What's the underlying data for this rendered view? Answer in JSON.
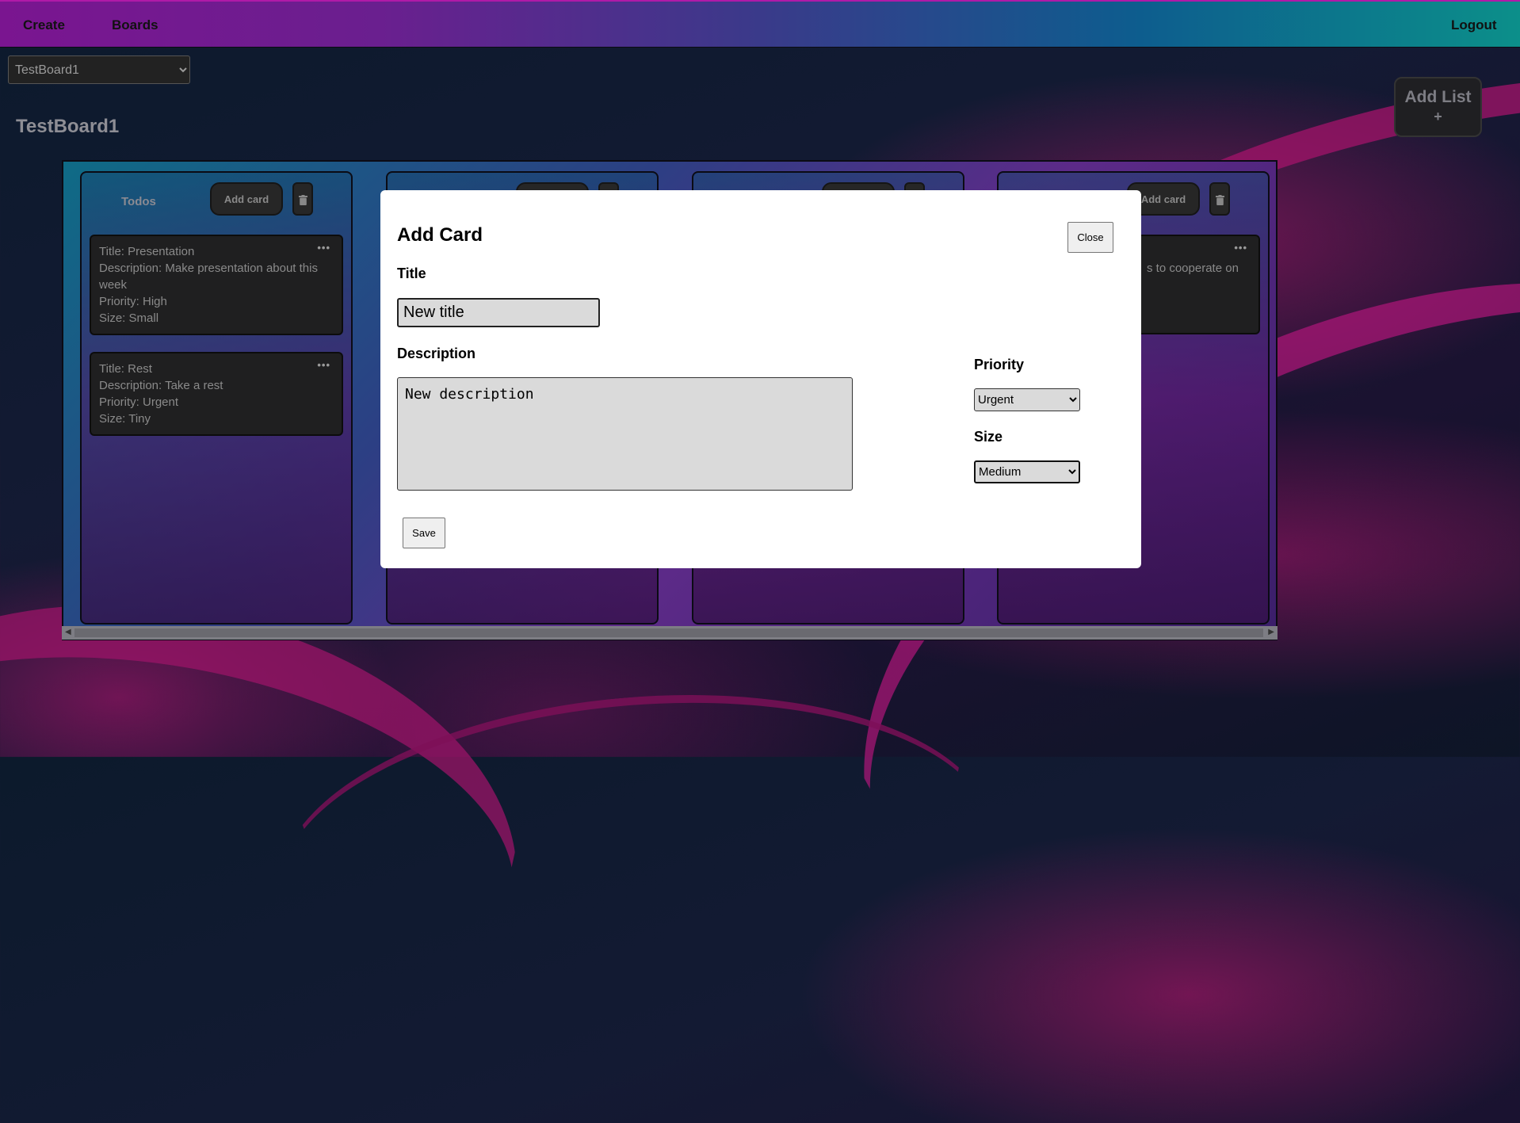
{
  "nav": {
    "create": "Create",
    "boards": "Boards",
    "logout": "Logout"
  },
  "board_select": {
    "selected": "TestBoard1"
  },
  "board_title": "TestBoard1",
  "add_list": {
    "label": "Add List",
    "plus": "+"
  },
  "lists": [
    {
      "title": "Todos",
      "add_card_label": "Add card",
      "cards": [
        {
          "lines": [
            "Title: Presentation",
            "Description: Make presentation about this week",
            "Priority: High",
            "Size: Small"
          ]
        },
        {
          "lines": [
            "Title: Rest",
            "Description: Take a rest",
            "Priority: Urgent",
            "Size: Tiny"
          ]
        }
      ]
    },
    {
      "title": "",
      "add_card_label": "",
      "cards": []
    },
    {
      "title": "",
      "add_card_label": "",
      "cards": []
    },
    {
      "title": "",
      "add_card_label": "Add card",
      "cards": [
        {
          "lines": [
            "s to cooperate on"
          ]
        }
      ]
    }
  ],
  "modal": {
    "heading": "Add Card",
    "close_label": "Close",
    "title_label": "Title",
    "title_value": "New title",
    "description_label": "Description",
    "description_value": "New description",
    "priority_label": "Priority",
    "priority_value": "Urgent",
    "size_label": "Size",
    "size_value": "Medium",
    "save_label": "Save"
  }
}
